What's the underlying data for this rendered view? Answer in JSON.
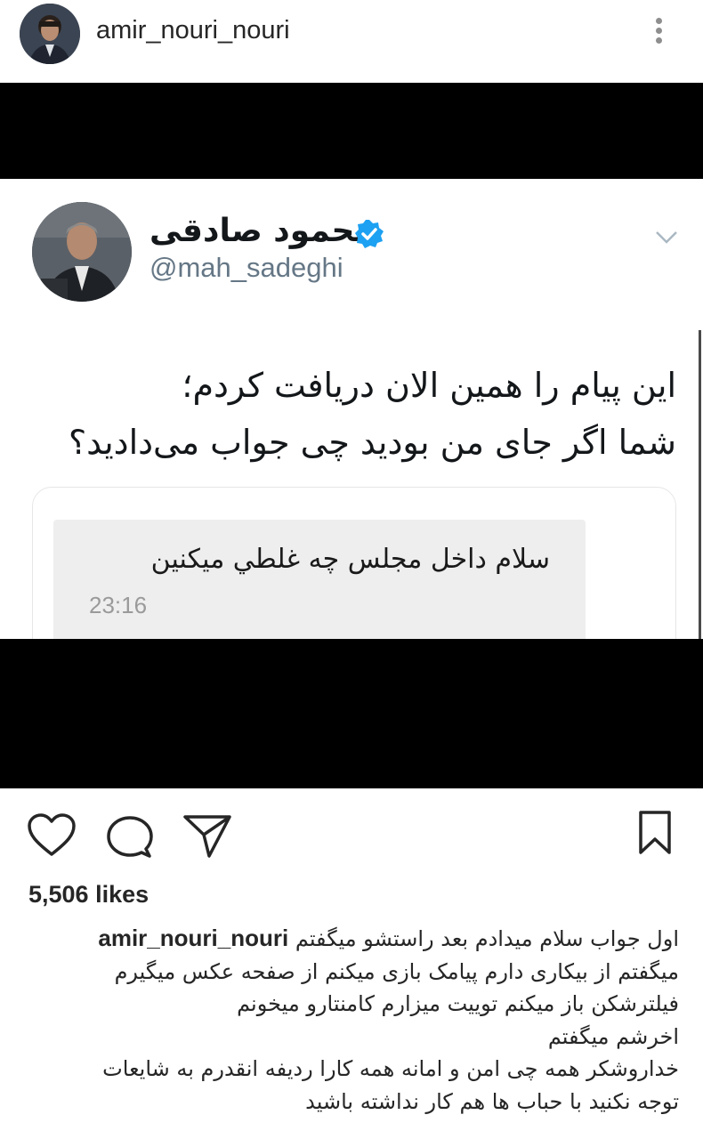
{
  "header": {
    "username": "amir_nouri_nouri",
    "avatar_icon": "profile-avatar",
    "more_icon": "more-vertical-icon"
  },
  "tweet": {
    "display_name": "محمود صادقی",
    "handle": "@mah_sadeghi",
    "verified_icon": "verified-badge-icon",
    "text_line_1": "این پیام را همین الان دریافت کردم؛",
    "text_line_2": "شما اگر جای من بودید چی جواب می‌دادید؟",
    "sms": {
      "message": "سلام داخل مجلس چه غلطي ميكنين",
      "time": "23:16"
    }
  },
  "actions": {
    "like_icon": "heart-icon",
    "comment_icon": "comment-icon",
    "share_icon": "send-icon",
    "save_icon": "bookmark-icon"
  },
  "likes": "5,506 likes",
  "caption": {
    "username": "amir_nouri_nouri",
    "lines": [
      "اول جواب سلام میدادم بعد راستشو میگفتم",
      "میگفتم از بیکاری دارم پیامک بازی میکنم از صفحه عکس میگیرم",
      "فیلترشکن باز میکنم توییت میزارم کامنتارو میخونم",
      "اخرشم میگفتم",
      "خداروشکر همه چی امن و امانه همه کارا ردیفه انقدرم به شایعات",
      "توجه نکنید با حباب ها هم کار نداشته باشید"
    ]
  },
  "colors": {
    "verified": "#1da1f2",
    "text": "#262626",
    "handle": "#657786"
  }
}
